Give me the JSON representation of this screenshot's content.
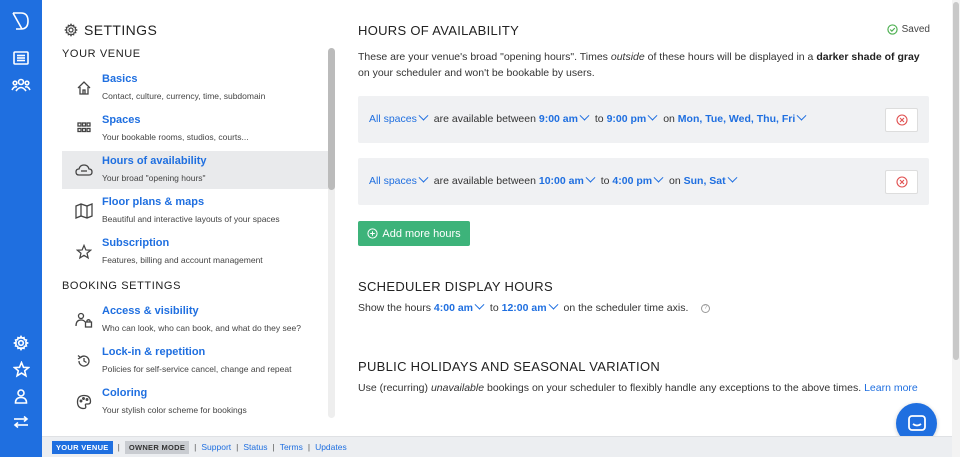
{
  "rail": {
    "icons": [
      "logo-icon",
      "list-icon",
      "users-icon",
      "gear-icon",
      "star-icon",
      "person-icon",
      "switch-icon"
    ]
  },
  "nav": {
    "title": "SETTINGS",
    "your_venue_header": "YOUR VENUE",
    "booking_header": "BOOKING SETTINGS",
    "items": [
      {
        "label": "Basics",
        "desc": "Contact, culture, currency, time, subdomain",
        "icon": "home-icon"
      },
      {
        "label": "Spaces",
        "desc": "Your bookable rooms, studios, courts...",
        "icon": "grid-icon"
      },
      {
        "label": "Hours of availability",
        "desc": "Your broad \"opening hours\"",
        "icon": "cloud-icon"
      },
      {
        "label": "Floor plans & maps",
        "desc": "Beautiful and interactive layouts of your spaces",
        "icon": "map-icon"
      },
      {
        "label": "Subscription",
        "desc": "Features, billing and account management",
        "icon": "star-icon"
      },
      {
        "label": "Access & visibility",
        "desc": "Who can look, who can book, and what do they see?",
        "icon": "users-lock-icon"
      },
      {
        "label": "Lock-in & repetition",
        "desc": "Policies for self-service cancel, change and repeat",
        "icon": "history-icon"
      },
      {
        "label": "Coloring",
        "desc": "Your stylish color scheme for bookings",
        "icon": "palette-icon"
      }
    ]
  },
  "main": {
    "hours_title": "HOURS OF AVAILABILITY",
    "saved": "Saved",
    "intro_1": "These are your venue's broad \"opening hours\". Times ",
    "intro_em": "outside",
    "intro_2": " of these hours will be displayed in a ",
    "intro_bold": "darker shade of gray",
    "intro_3": " on your scheduler and won't be bookable by users.",
    "rules": [
      {
        "spaces": "All spaces",
        "mid": "are available between",
        "from": "9:00 am",
        "to_word": "to",
        "to": "9:00 pm",
        "on_word": "on",
        "days": "Mon, Tue, Wed, Thu, Fri"
      },
      {
        "spaces": "All spaces",
        "mid": "are available between",
        "from": "10:00 am",
        "to_word": "to",
        "to": "4:00 pm",
        "on_word": "on",
        "days": "Sun, Sat"
      }
    ],
    "add_button": "Add more hours",
    "scheduler_title": "SCHEDULER DISPLAY HOURS",
    "scheduler_1": "Show the hours",
    "scheduler_from": "4:00 am",
    "scheduler_to_word": "to",
    "scheduler_to": "12:00 am",
    "scheduler_2": "on the scheduler time axis.",
    "holidays_title": "PUBLIC HOLIDAYS AND SEASONAL VARIATION",
    "holidays_1": "Use (recurring) ",
    "holidays_em": "unavailable",
    "holidays_2": " bookings on your scheduler to flexibly handle any exceptions to the above times. ",
    "holidays_link": "Learn more"
  },
  "footer": {
    "venue_badge": "YOUR VENUE",
    "owner_badge": "OWNER MODE",
    "links": [
      "Support",
      "Status",
      "Terms",
      "Updates"
    ]
  },
  "colors": {
    "brand_blue": "#1f6fe0",
    "add_green": "#3db37a",
    "delete_red": "#e05050",
    "active_bg": "#e9eaec"
  }
}
